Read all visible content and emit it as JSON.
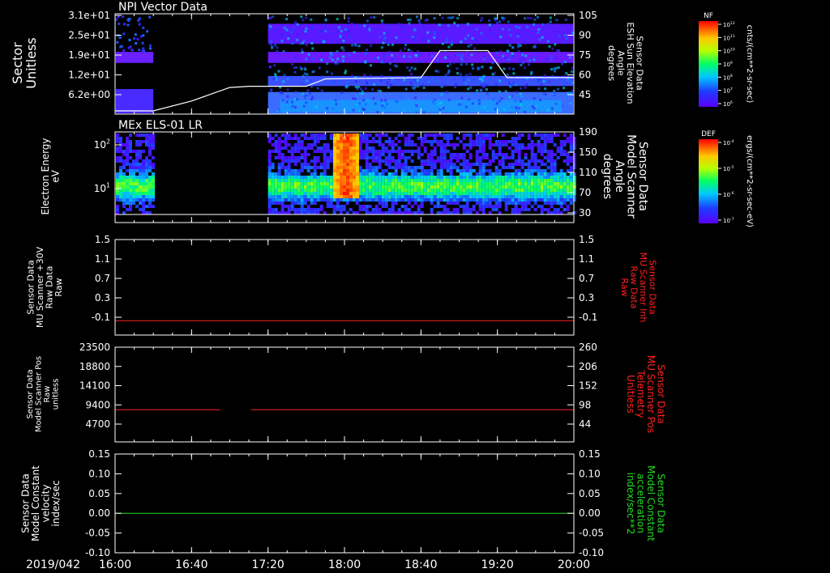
{
  "time_axis": {
    "date_label": "2019/042",
    "ticks": [
      "16:00",
      "16:40",
      "17:20",
      "18:00",
      "18:40",
      "19:20",
      "20:00"
    ],
    "range": [
      "16:00",
      "20:00"
    ]
  },
  "colors": {
    "axis": "#ffffff",
    "red_line": "#ff2020",
    "green_line": "#22dd22",
    "white_line": "#ffffff"
  },
  "chart_data": [
    {
      "type": "heatmap",
      "id": "panel1",
      "title": "NPI Vector Data",
      "ylabel": [
        "Sector",
        "Unitless"
      ],
      "y_ticks": [
        "3.1e+01",
        "2.5e+01",
        "1.9e+01",
        "1.2e+01",
        "6.2e+00"
      ],
      "y2_ticks": [
        "105",
        "90",
        "75",
        "60",
        "45"
      ],
      "y2_label": [
        "Sensor Data",
        "ESH Sun Elevation",
        "Angle",
        "degrees"
      ],
      "colorbar": {
        "label": "NF",
        "unit": "cnts/(cm**2-sr-sec)",
        "ticks": [
          "10^12",
          "10^11",
          "10^10",
          "10^9",
          "10^8",
          "10^7",
          "10^6"
        ]
      },
      "overlay_series": {
        "name": "ESH Sun Elevation Angle",
        "color": "#ffffff",
        "x": [
          "16:00",
          "16:20",
          "16:40",
          "17:00",
          "17:10",
          "17:40",
          "17:50",
          "18:40",
          "18:50",
          "19:15",
          "19:25",
          "20:00"
        ],
        "y": [
          30,
          30,
          38,
          49,
          50,
          50,
          56,
          57,
          79,
          79,
          57,
          57
        ]
      }
    },
    {
      "type": "heatmap",
      "id": "panel2",
      "title": "MEx ELS-01 LR",
      "ylabel": [
        "Electron Energy",
        "eV"
      ],
      "y_ticks": [
        "10^2",
        "10^1"
      ],
      "y2_ticks": [
        "190",
        "150",
        "110",
        "70",
        "30"
      ],
      "y2_label": [
        "Sensor Data",
        "Model Scanner",
        "Angle",
        "degrees"
      ],
      "colorbar": {
        "label": "DEF",
        "unit": "ergs/(cm**2-sr-sec-eV)",
        "ticks": [
          "10^-4",
          "10^-5",
          "10^-6",
          "10^-7"
        ]
      },
      "overlay_series": {
        "name": "Model Scanner Angle",
        "color": "#ffffff",
        "x": [
          "16:00",
          "20:00"
        ],
        "y": [
          10,
          10
        ]
      }
    },
    {
      "type": "line",
      "id": "panel3",
      "ylabel": [
        "Sensor Data",
        "MU Scanner +30V",
        "Raw Data",
        "Raw"
      ],
      "y_ticks": [
        "1.5",
        "1.1",
        "0.7",
        "0.3",
        "-0.1"
      ],
      "ylim": [
        -0.3,
        1.5
      ],
      "y2_ticks": [
        "1.5",
        "1.1",
        "0.7",
        "0.3",
        "-0.1"
      ],
      "y2_label": [
        "Sensor Data",
        "MU Scanner Inh",
        "Raw Data",
        "Raw"
      ],
      "series": [
        {
          "color": "#ff2020",
          "x": [
            "16:00",
            "20:00"
          ],
          "y": [
            -0.03,
            -0.03
          ]
        }
      ]
    },
    {
      "type": "line",
      "id": "panel4",
      "ylabel": [
        "Sensor Data",
        "Model Scanner Pos",
        "Raw",
        "unitless"
      ],
      "y_ticks": [
        "23500",
        "18800",
        "14100",
        "9400",
        "4700"
      ],
      "ylim": [
        0,
        23500
      ],
      "y2_ticks": [
        "260",
        "206",
        "152",
        "98",
        "44"
      ],
      "y2_label": [
        "Sensor Data",
        "MU Scanner Pos",
        "Telemetry",
        "Unitless"
      ],
      "series": [
        {
          "color": "#ff2020",
          "x": [
            "16:00",
            "16:55"
          ],
          "y": [
            8000,
            8000
          ]
        },
        {
          "color": "#ff2020",
          "x": [
            "17:11",
            "20:00"
          ],
          "y": [
            8000,
            8000
          ]
        }
      ]
    },
    {
      "type": "line",
      "id": "panel5",
      "ylabel": [
        "Sensor Data",
        "Model Constant",
        "velocity",
        "index/sec"
      ],
      "y_ticks": [
        "0.15",
        "0.10",
        "0.05",
        "0.00",
        "-0.05",
        "-0.10"
      ],
      "ylim": [
        -0.1,
        0.15
      ],
      "y2_ticks": [
        "0.15",
        "0.10",
        "0.05",
        "0.00",
        "-0.05",
        "-0.10"
      ],
      "y2_label": [
        "Sensor Data",
        "Model Constant",
        "acceleration",
        "index/sec**2"
      ],
      "series": [
        {
          "color": "#22dd22",
          "x": [
            "16:00",
            "20:00"
          ],
          "y": [
            0,
            0
          ]
        }
      ]
    }
  ]
}
